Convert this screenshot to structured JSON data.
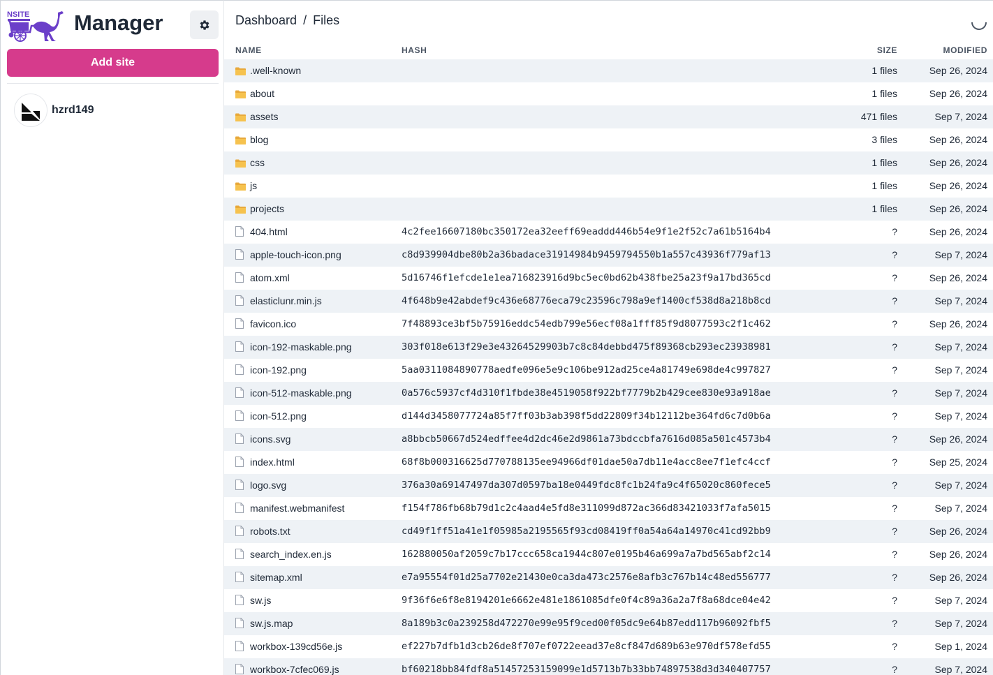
{
  "app": {
    "brand_text": "NSITE",
    "title": "Manager",
    "add_site_label": "Add site",
    "accent_color": "#d63b8c",
    "brand_color": "#6b3fc9"
  },
  "sites": [
    {
      "name": "hzrd149"
    }
  ],
  "breadcrumb": {
    "root": "Dashboard",
    "separator": "/",
    "current": "Files"
  },
  "table": {
    "headers": {
      "name": "NAME",
      "hash": "HASH",
      "size": "SIZE",
      "modified": "MODIFIED"
    },
    "rows": [
      {
        "type": "folder",
        "name": ".well-known",
        "hash": "",
        "size": "1 files",
        "modified": "Sep 26, 2024"
      },
      {
        "type": "folder",
        "name": "about",
        "hash": "",
        "size": "1 files",
        "modified": "Sep 26, 2024"
      },
      {
        "type": "folder",
        "name": "assets",
        "hash": "",
        "size": "471 files",
        "modified": "Sep 7, 2024"
      },
      {
        "type": "folder",
        "name": "blog",
        "hash": "",
        "size": "3 files",
        "modified": "Sep 26, 2024"
      },
      {
        "type": "folder",
        "name": "css",
        "hash": "",
        "size": "1 files",
        "modified": "Sep 26, 2024"
      },
      {
        "type": "folder",
        "name": "js",
        "hash": "",
        "size": "1 files",
        "modified": "Sep 26, 2024"
      },
      {
        "type": "folder",
        "name": "projects",
        "hash": "",
        "size": "1 files",
        "modified": "Sep 26, 2024"
      },
      {
        "type": "file",
        "name": "404.html",
        "hash": "4c2fee16607180bc350172ea32eeff69eaddd446b54e9f1e2f52c7a61b5164b4",
        "size": "?",
        "modified": "Sep 26, 2024"
      },
      {
        "type": "file",
        "name": "apple-touch-icon.png",
        "hash": "c8d939904dbe80b2a36badace31914984b9459794550b1a557c43936f779af13",
        "size": "?",
        "modified": "Sep 7, 2024"
      },
      {
        "type": "file",
        "name": "atom.xml",
        "hash": "5d16746f1efcde1e1ea716823916d9bc5ec0bd62b438fbe25a23f9a17bd365cd",
        "size": "?",
        "modified": "Sep 26, 2024"
      },
      {
        "type": "file",
        "name": "elasticlunr.min.js",
        "hash": "4f648b9e42abdef9c436e68776eca79c23596c798a9ef1400cf538d8a218b8cd",
        "size": "?",
        "modified": "Sep 7, 2024"
      },
      {
        "type": "file",
        "name": "favicon.ico",
        "hash": "7f48893ce3bf5b75916eddc54edb799e56ecf08a1fff85f9d8077593c2f1c462",
        "size": "?",
        "modified": "Sep 26, 2024"
      },
      {
        "type": "file",
        "name": "icon-192-maskable.png",
        "hash": "303f018e613f29e3e43264529903b7c8c84debbd475f89368cb293ec23938981",
        "size": "?",
        "modified": "Sep 7, 2024"
      },
      {
        "type": "file",
        "name": "icon-192.png",
        "hash": "5aa0311084890778aedfe096e5e9c106be912ad25ce4a81749e698de4c997827",
        "size": "?",
        "modified": "Sep 7, 2024"
      },
      {
        "type": "file",
        "name": "icon-512-maskable.png",
        "hash": "0a576c5937cf4d310f1fbde38e4519058f922bf7779b2b429cee830e93a918ae",
        "size": "?",
        "modified": "Sep 7, 2024"
      },
      {
        "type": "file",
        "name": "icon-512.png",
        "hash": "d144d3458077724a85f7ff03b3ab398f5dd22809f34b12112be364fd6c7d0b6a",
        "size": "?",
        "modified": "Sep 7, 2024"
      },
      {
        "type": "file",
        "name": "icons.svg",
        "hash": "a8bbcb50667d524edffee4d2dc46e2d9861a73bdccbfa7616d085a501c4573b4",
        "size": "?",
        "modified": "Sep 26, 2024"
      },
      {
        "type": "file",
        "name": "index.html",
        "hash": "68f8b000316625d770788135ee94966df01dae50a7db11e4acc8ee7f1efc4ccf",
        "size": "?",
        "modified": "Sep 25, 2024"
      },
      {
        "type": "file",
        "name": "logo.svg",
        "hash": "376a30a69147497da307d0597ba18e0449fdc8fc1b24fa9c4f65020c860fece5",
        "size": "?",
        "modified": "Sep 7, 2024"
      },
      {
        "type": "file",
        "name": "manifest.webmanifest",
        "hash": "f154f786fb68b79d1c2c4aad4e5fd8e311099d872ac366d83421033f7afa5015",
        "size": "?",
        "modified": "Sep 7, 2024"
      },
      {
        "type": "file",
        "name": "robots.txt",
        "hash": "cd49f1ff51a41e1f05985a2195565f93cd08419ff0a54a64a14970c41cd92bb9",
        "size": "?",
        "modified": "Sep 26, 2024"
      },
      {
        "type": "file",
        "name": "search_index.en.js",
        "hash": "162880050af2059c7b17ccc658ca1944c807e0195b46a699a7a7bd565abf2c14",
        "size": "?",
        "modified": "Sep 26, 2024"
      },
      {
        "type": "file",
        "name": "sitemap.xml",
        "hash": "e7a95554f01d25a7702e21430e0ca3da473c2576e8afb3c767b14c48ed556777",
        "size": "?",
        "modified": "Sep 26, 2024"
      },
      {
        "type": "file",
        "name": "sw.js",
        "hash": "9f36f6e6f8e8194201e6662e481e1861085dfe0f4c89a36a2a7f8a68dce04e42",
        "size": "?",
        "modified": "Sep 7, 2024"
      },
      {
        "type": "file",
        "name": "sw.js.map",
        "hash": "8a189b3c0a239258d472270e99e95f9ced00f05dc9e64b87edd117b96092fbf5",
        "size": "?",
        "modified": "Sep 7, 2024"
      },
      {
        "type": "file",
        "name": "workbox-139cd56e.js",
        "hash": "ef227b7dfb1d3cb26de8f707ef0722eead37e8cf847d689b63e970df578efd55",
        "size": "?",
        "modified": "Sep 1, 2024"
      },
      {
        "type": "file",
        "name": "workbox-7cfec069.js",
        "hash": "bf60218bb84fdf8a51457253159099e1d5713b7b33bb74897538d3d340407757",
        "size": "?",
        "modified": "Sep 7, 2024"
      }
    ]
  }
}
